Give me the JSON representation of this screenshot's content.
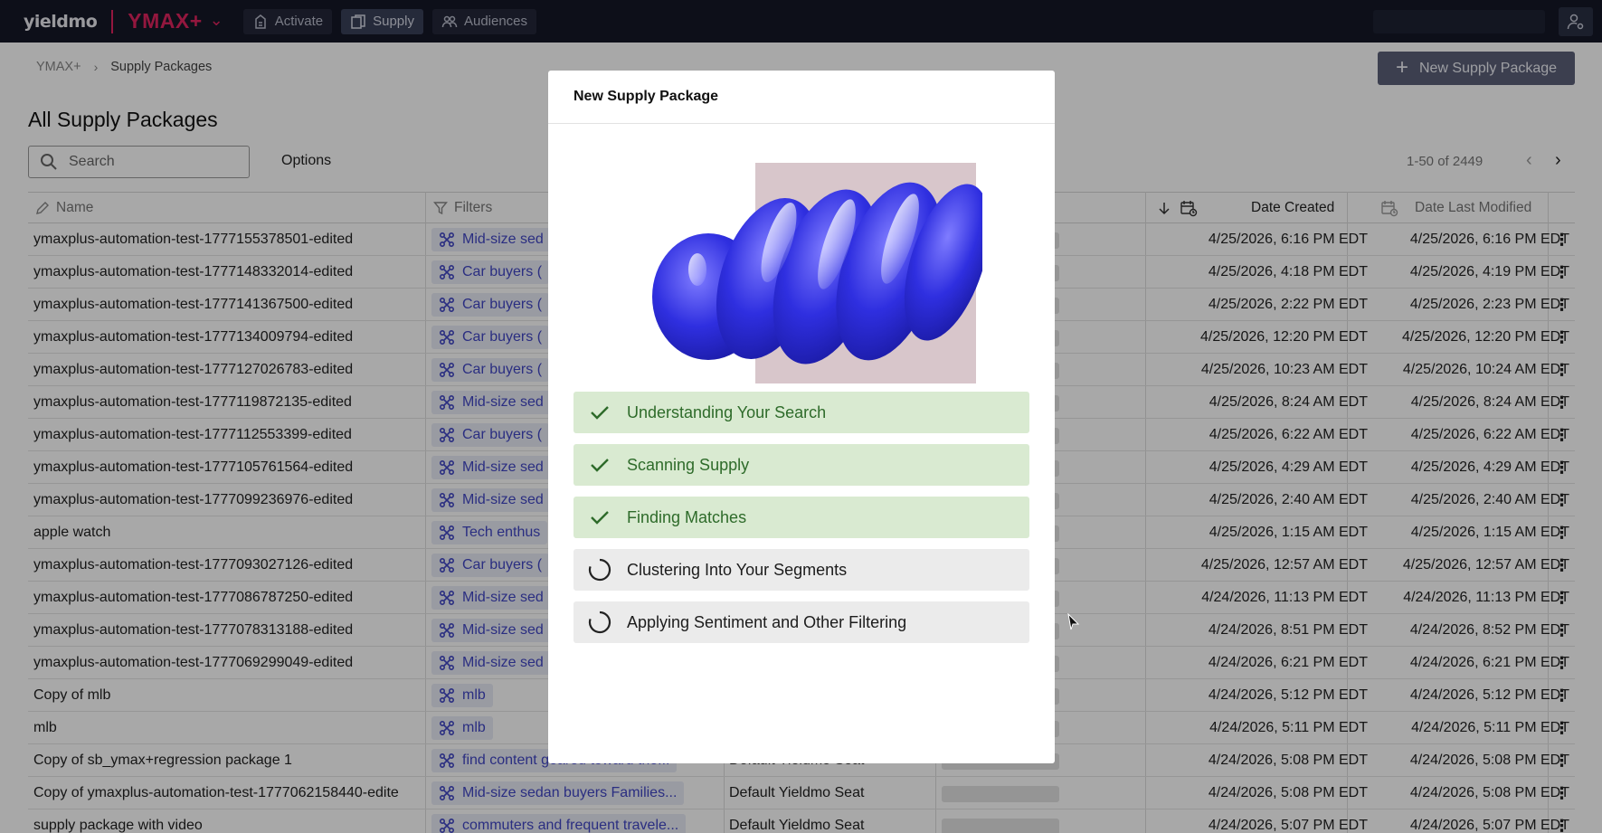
{
  "topbar": {
    "logo": "yieldmo",
    "product": "YMAX+",
    "nav": [
      {
        "label": "Activate",
        "icon": "activate-icon"
      },
      {
        "label": "Supply",
        "icon": "supply-icon"
      },
      {
        "label": "Audiences",
        "icon": "audiences-icon"
      }
    ]
  },
  "breadcrumb": {
    "root": "YMAX+",
    "current": "Supply Packages"
  },
  "new_button_label": "New Supply Package",
  "page_title": "All Supply Packages",
  "search": {
    "placeholder": "Search"
  },
  "options_label": "Options",
  "pagination": {
    "text": "1-50 of 2449"
  },
  "table": {
    "headers": {
      "name": "Name",
      "filters": "Filters",
      "date_created": "Date Created",
      "date_modified": "Date Last Modified"
    },
    "rows": [
      {
        "name": "ymaxplus-automation-test-1777155378501-edited",
        "filter": "Mid-size sed",
        "seat": "",
        "created": "4/25/2026, 6:16 PM EDT",
        "modified": "4/25/2026, 6:16 PM EDT"
      },
      {
        "name": "ymaxplus-automation-test-1777148332014-edited",
        "filter": "Car buyers (",
        "seat": "",
        "created": "4/25/2026, 4:18 PM EDT",
        "modified": "4/25/2026, 4:19 PM EDT"
      },
      {
        "name": "ymaxplus-automation-test-1777141367500-edited",
        "filter": "Car buyers (",
        "seat": "",
        "created": "4/25/2026, 2:22 PM EDT",
        "modified": "4/25/2026, 2:23 PM EDT"
      },
      {
        "name": "ymaxplus-automation-test-1777134009794-edited",
        "filter": "Car buyers (",
        "seat": "",
        "created": "4/25/2026, 12:20 PM EDT",
        "modified": "4/25/2026, 12:20 PM EDT"
      },
      {
        "name": "ymaxplus-automation-test-1777127026783-edited",
        "filter": "Car buyers (",
        "seat": "",
        "created": "4/25/2026, 10:23 AM EDT",
        "modified": "4/25/2026, 10:24 AM EDT"
      },
      {
        "name": "ymaxplus-automation-test-1777119872135-edited",
        "filter": "Mid-size sed",
        "seat": "",
        "created": "4/25/2026, 8:24 AM EDT",
        "modified": "4/25/2026, 8:24 AM EDT"
      },
      {
        "name": "ymaxplus-automation-test-1777112553399-edited",
        "filter": "Car buyers (",
        "seat": "",
        "created": "4/25/2026, 6:22 AM EDT",
        "modified": "4/25/2026, 6:22 AM EDT"
      },
      {
        "name": "ymaxplus-automation-test-1777105761564-edited",
        "filter": "Mid-size sed",
        "seat": "",
        "created": "4/25/2026, 4:29 AM EDT",
        "modified": "4/25/2026, 4:29 AM EDT"
      },
      {
        "name": "ymaxplus-automation-test-1777099236976-edited",
        "filter": "Mid-size sed",
        "seat": "",
        "created": "4/25/2026, 2:40 AM EDT",
        "modified": "4/25/2026, 2:40 AM EDT"
      },
      {
        "name": "apple watch",
        "filter": "Tech enthus",
        "seat": "",
        "created": "4/25/2026, 1:15 AM EDT",
        "modified": "4/25/2026, 1:15 AM EDT"
      },
      {
        "name": "ymaxplus-automation-test-1777093027126-edited",
        "filter": "Car buyers (",
        "seat": "",
        "created": "4/25/2026, 12:57 AM EDT",
        "modified": "4/25/2026, 12:57 AM EDT"
      },
      {
        "name": "ymaxplus-automation-test-1777086787250-edited",
        "filter": "Mid-size sed",
        "seat": "",
        "created": "4/24/2026, 11:13 PM EDT",
        "modified": "4/24/2026, 11:13 PM EDT"
      },
      {
        "name": "ymaxplus-automation-test-1777078313188-edited",
        "filter": "Mid-size sed",
        "seat": "",
        "created": "4/24/2026, 8:51 PM EDT",
        "modified": "4/24/2026, 8:52 PM EDT"
      },
      {
        "name": "ymaxplus-automation-test-1777069299049-edited",
        "filter": "Mid-size sed",
        "seat": "",
        "created": "4/24/2026, 6:21 PM EDT",
        "modified": "4/24/2026, 6:21 PM EDT"
      },
      {
        "name": "Copy of mlb",
        "filter": "mlb",
        "seat": "",
        "created": "4/24/2026, 5:12 PM EDT",
        "modified": "4/24/2026, 5:12 PM EDT"
      },
      {
        "name": "mlb",
        "filter": "mlb",
        "seat": "",
        "created": "4/24/2026, 5:11 PM EDT",
        "modified": "4/24/2026, 5:11 PM EDT"
      },
      {
        "name": "Copy of sb_ymax+regression package 1",
        "filter": "find content geared toward the...",
        "seat": "Default Yieldmo Seat",
        "created": "4/24/2026, 5:08 PM EDT",
        "modified": "4/24/2026, 5:08 PM EDT"
      },
      {
        "name": "Copy of ymaxplus-automation-test-1777062158440-edite",
        "filter": "Mid-size sedan buyers Families...",
        "seat": "Default Yieldmo Seat",
        "created": "4/24/2026, 5:08 PM EDT",
        "modified": "4/24/2026, 5:08 PM EDT"
      },
      {
        "name": "supply package with video",
        "filter": "commuters and frequent travele...",
        "seat": "Default Yieldmo Seat",
        "created": "4/24/2026, 5:07 PM EDT",
        "modified": "4/24/2026, 5:07 PM EDT"
      }
    ]
  },
  "modal": {
    "title": "New Supply Package",
    "steps": [
      {
        "label": "Understanding Your Search",
        "status": "done"
      },
      {
        "label": "Scanning Supply",
        "status": "done"
      },
      {
        "label": "Finding Matches",
        "status": "done"
      },
      {
        "label": "Clustering Into Your Segments",
        "status": "in-progress"
      },
      {
        "label": "Applying Sentiment and Other Filtering",
        "status": "in-progress"
      }
    ]
  },
  "colors": {
    "nav_bg": "#141726",
    "brand": "#e0245e",
    "chip_text": "#4146c4",
    "step_done_bg": "#d9ead1",
    "step_done_text": "#2e6b2a",
    "step_pending_bg": "#ebebeb",
    "art_blue": "#2f2fe0"
  }
}
